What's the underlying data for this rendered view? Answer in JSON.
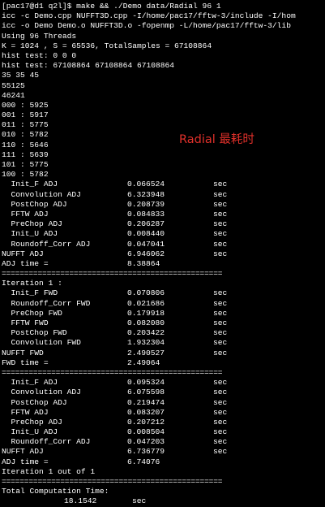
{
  "terminal": {
    "header_lines": [
      "[pac17@d1 q2l]$ make && ./Demo data/Radial 96 1",
      "icc -c Demo.cpp NUFFT3D.cpp -I/home/pac17/fftw-3/include -I/hom",
      "icc -o Demo Demo.o NUFFT3D.o -fopenmp -L/home/pac17/fftw-3/lib",
      "Using 96 Threads",
      "K = 1024 , S = 65536, TotalSamples = 67108864",
      "hist test: 0 0 0",
      "hist test: 67108864 67108864 67108864",
      "35 35 45",
      "55125",
      "46241",
      "000 : 5925",
      "001 : 5917",
      "011 : 5775",
      "010 : 5782",
      "110 : 5646",
      "111 : 5639",
      "101 : 5775",
      "100 : 5782"
    ],
    "block1": {
      "rows": [
        {
          "label": "  Init_F ADJ",
          "value": "0.066524",
          "unit": "sec"
        },
        {
          "label": "  Convolution ADJ",
          "value": "6.323948",
          "unit": "sec"
        },
        {
          "label": "  PostChop ADJ",
          "value": "0.208739",
          "unit": "sec"
        },
        {
          "label": "  FFTW ADJ",
          "value": "0.084833",
          "unit": "sec"
        },
        {
          "label": "  PreChop ADJ",
          "value": "0.206287",
          "unit": "sec"
        },
        {
          "label": "  Init_U ADJ",
          "value": "0.008440",
          "unit": "sec"
        },
        {
          "label": "  Roundoff_Corr ADJ",
          "value": "0.047041",
          "unit": "sec"
        },
        {
          "label": "NUFFT ADJ",
          "value": "6.946062",
          "unit": "sec"
        }
      ],
      "time_line": "ADJ time =",
      "time_value": "8.38864"
    },
    "separator": "=================================================",
    "block2": {
      "header": "Iteration 1 :",
      "rows": [
        {
          "label": "  Init_F FWD",
          "value": "0.070806",
          "unit": "sec"
        },
        {
          "label": "  Roundoff_Corr FWD",
          "value": "0.021686",
          "unit": "sec"
        },
        {
          "label": "  PreChop FWD",
          "value": "0.179918",
          "unit": "sec"
        },
        {
          "label": "  FFTW FWD",
          "value": "0.082080",
          "unit": "sec"
        },
        {
          "label": "  PostChop FWD",
          "value": "0.203422",
          "unit": "sec"
        },
        {
          "label": "  Convolution FWD",
          "value": "1.932304",
          "unit": "sec"
        },
        {
          "label": "NUFFT FWD",
          "value": "2.490527",
          "unit": "sec"
        }
      ],
      "time_line": "FWD time =",
      "time_value": "2.49064"
    },
    "block3": {
      "rows": [
        {
          "label": "  Init_F ADJ",
          "value": "0.095324",
          "unit": "sec"
        },
        {
          "label": "  Convolution ADJ",
          "value": "6.075598",
          "unit": "sec"
        },
        {
          "label": "  PostChop ADJ",
          "value": "0.219474",
          "unit": "sec"
        },
        {
          "label": "  FFTW ADJ",
          "value": "0.083207",
          "unit": "sec"
        },
        {
          "label": "  PreChop ADJ",
          "value": "0.207212",
          "unit": "sec"
        },
        {
          "label": "  Init_U ADJ",
          "value": "0.008504",
          "unit": "sec"
        },
        {
          "label": "  Roundoff_Corr ADJ",
          "value": "0.047203",
          "unit": "sec"
        },
        {
          "label": "NUFFT ADJ",
          "value": "6.736779",
          "unit": "sec"
        }
      ],
      "time_line": "ADJ time =",
      "time_value": "6.74076",
      "iteration_done": "Iteration 1 out of 1"
    },
    "footer": {
      "label": "Total Computation Time:",
      "value": "18.1542",
      "unit": "sec"
    }
  },
  "annotation": {
    "text": "Radial 最耗时",
    "color": "#e0302a"
  },
  "colors": {
    "background": "#000000",
    "text": "#ffffff"
  }
}
